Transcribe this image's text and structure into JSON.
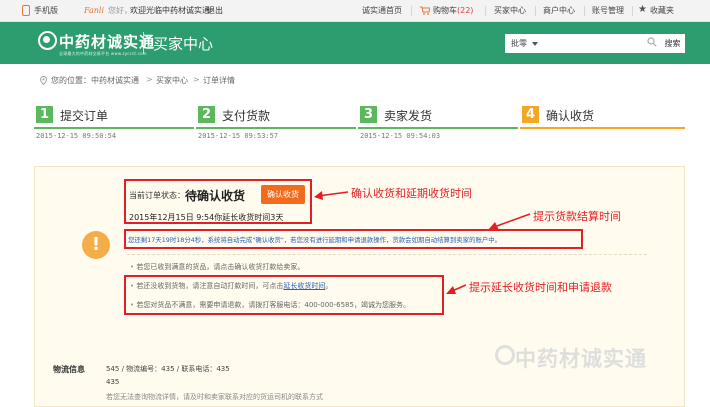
{
  "topbar": {
    "phone_label": "手机版",
    "fanli": "Fanli",
    "welcome": "您好，",
    "site_name": "欢迎光临中药材诚实通",
    "logout": "退出",
    "home": "诚实通首页",
    "cart_label": "购物车",
    "cart_count": "(22)",
    "buyer_center": "买家中心",
    "seller_center": "商户中心",
    "account": "账号管理",
    "favorites": "收藏夹"
  },
  "header": {
    "logo_text": "中药材诚实通",
    "logo_sub": "全球最大的中药材交易平台  www.zyccst.com",
    "title": "买家中心",
    "search_select": "批零",
    "search_placeholder": "",
    "search_button": "搜索"
  },
  "breadcrumb": {
    "prefix": "您的位置：",
    "items": [
      "中药材诚实通",
      "买家中心",
      "订单详情"
    ],
    "separator": ">"
  },
  "steps": [
    {
      "num": "1",
      "label": "提交订单",
      "time": "2015-12-15  09:50:54",
      "color": "#5cb85c"
    },
    {
      "num": "2",
      "label": "支付货款",
      "time": "2015-12-15  09:53:57",
      "color": "#5cb85c"
    },
    {
      "num": "3",
      "label": "卖家发货",
      "time": "2015-12-15  09:54:03",
      "color": "#5cb85c"
    },
    {
      "num": "4",
      "label": "确认收货",
      "time": "",
      "color": "#f5a623"
    }
  ],
  "status": {
    "label": "当前订单状态：",
    "value": "待确认收货",
    "confirm_button": "确认收货",
    "deadline": "2015年12月15日 9:54你延长收货时间3天",
    "tip1": "您还剩17天19时18分4秒，系统将自动完成\"确认收货\"，若您没有进行延期和申请退款操作，货款会如期自动结算到卖家的账户中。",
    "tip2": "若您已收到满意的货品，请点击确认收货打款给卖家。",
    "tip3_prefix": "若还没收到货物，请注意自动打款时间，可点击",
    "tip3_link": "延长收货时间",
    "tip3_suffix": "。",
    "tip4": "若您对货品不满意，需要申请退款，请拨打客服电话：400-000-6585，竭诚为您服务。"
  },
  "annotations": {
    "a1": "确认收货和延期收货时间",
    "a2": "提示货款结算时间",
    "a3": "提示延长收货时间和申请退款"
  },
  "logistics": {
    "title": "物流信息",
    "line1": "545 / 物流编号：435 / 联系电话：435",
    "line2": "435",
    "note": "若您无法查询物流详情，请及时和卖家联系对应的货运司机的联系方式"
  },
  "watermark": "中药材诚实通",
  "colors": {
    "brand_green": "#2d9d6f",
    "step_green": "#5cb85c",
    "step_orange": "#f5a623",
    "confirm_orange": "#f26b1d",
    "annotation_red": "#e31e24"
  }
}
